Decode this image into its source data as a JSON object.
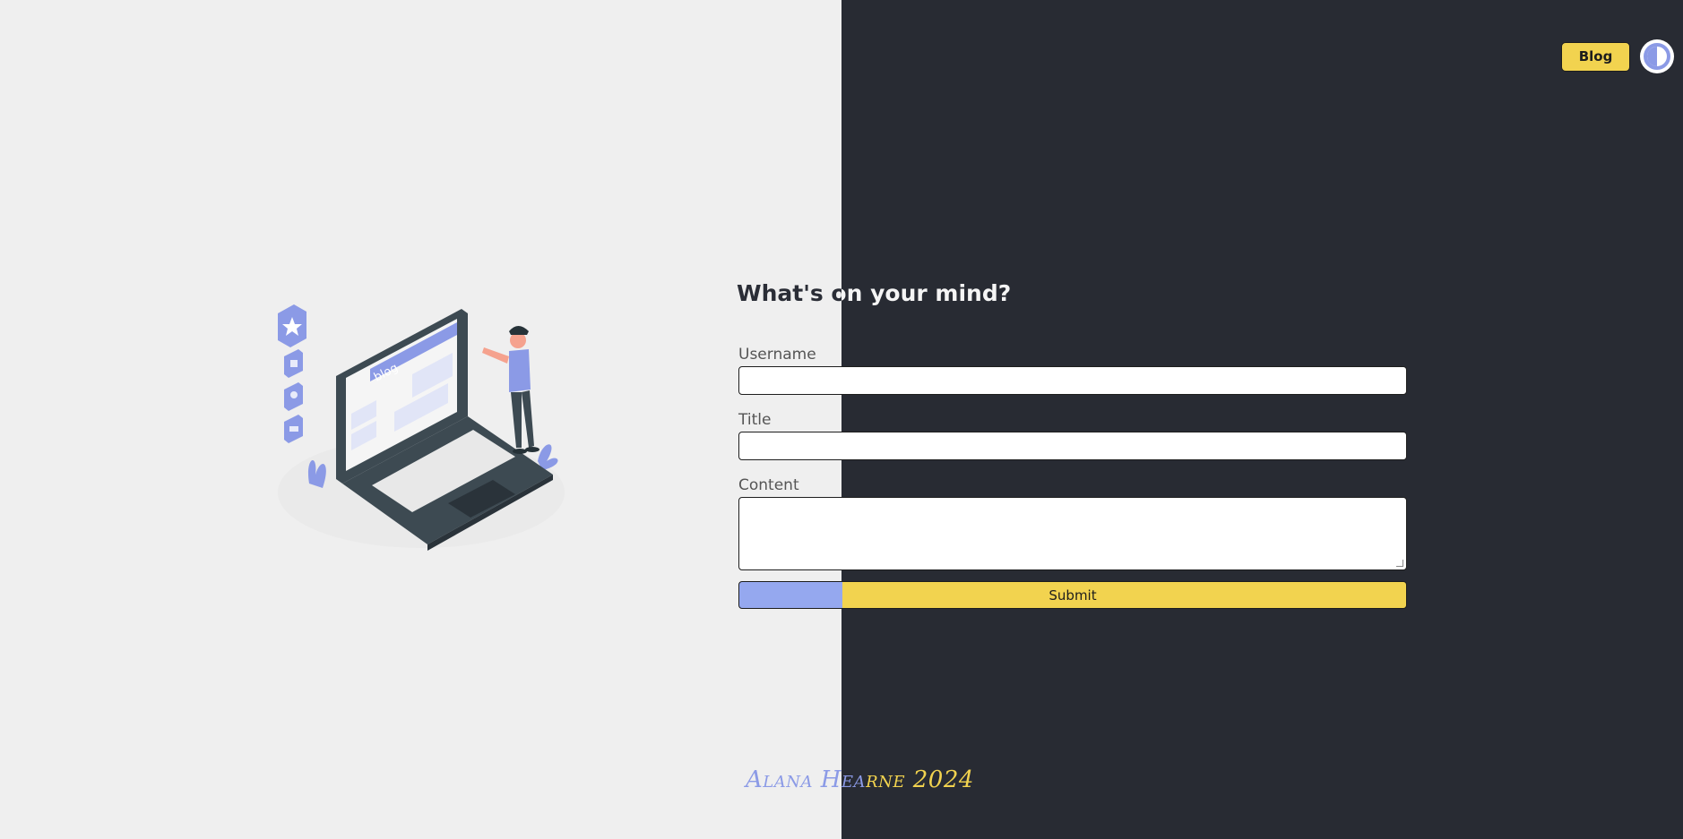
{
  "header": {
    "blog_label": "Blog",
    "theme_toggle_icon": "contrast-icon"
  },
  "illustration": {
    "name": "blogging-laptop-illustration",
    "screen_text": "blog"
  },
  "form": {
    "heading": "What's on your mind?",
    "username_label": "Username",
    "username_value": "",
    "title_label": "Title",
    "title_value": "",
    "content_label": "Content",
    "content_value": "",
    "submit_label": "Submit"
  },
  "footer": {
    "text_light_part": "Alana Hea",
    "text_dark_part": "rne 2024"
  },
  "colors": {
    "accent_yellow": "#f2d34f",
    "accent_blue": "#8b9ae6",
    "dark_bg": "#282b33",
    "light_bg": "#efefef"
  }
}
